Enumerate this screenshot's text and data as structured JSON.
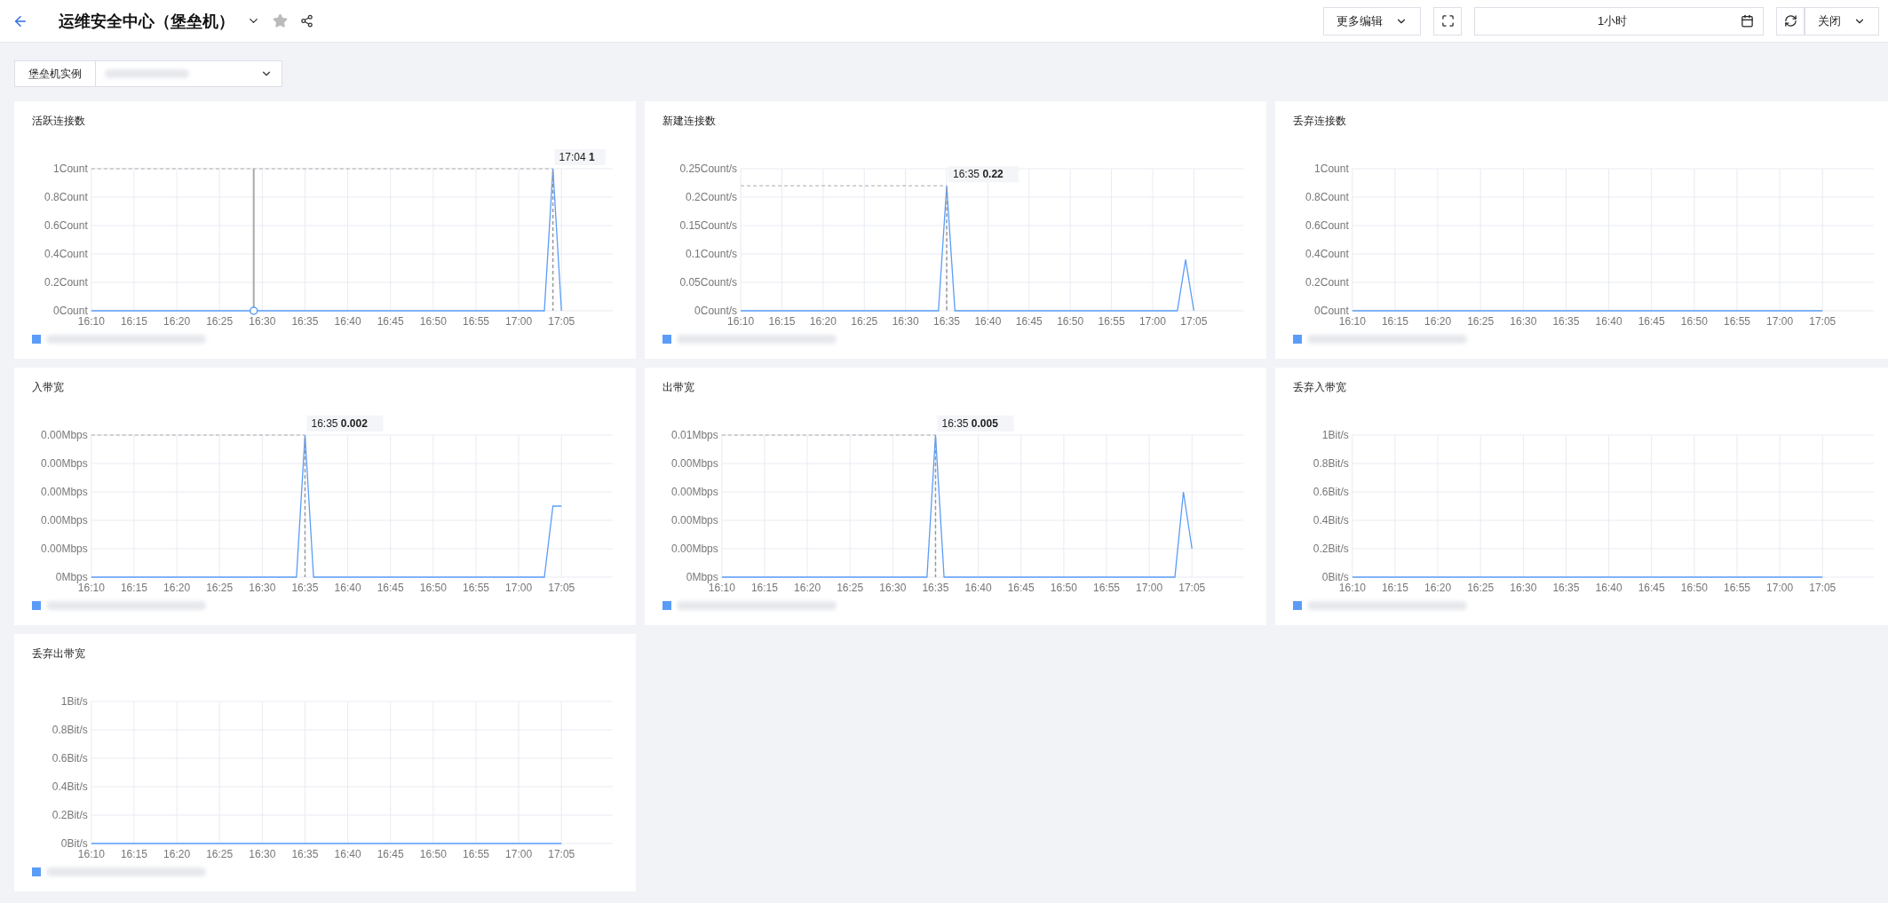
{
  "header": {
    "title": "运维安全中心（堡垒机）",
    "starred": false,
    "buttons": [
      {
        "kind": "dropdown",
        "label": "更多编辑"
      },
      {
        "kind": "fullscreen"
      },
      {
        "kind": "timerange",
        "label": "1小时"
      },
      {
        "kind": "refresh"
      },
      {
        "kind": "dropdown",
        "label": "关闭"
      }
    ]
  },
  "filter": {
    "label": "堡垒机实例"
  },
  "panels": [
    {
      "title": "活跃连接数",
      "tooltip": {
        "time": "17:04",
        "value": "1"
      },
      "chart_data": {
        "type": "line",
        "grid": true,
        "categories": [
          "16:10",
          null,
          null,
          null,
          null,
          "16:15",
          null,
          null,
          null,
          null,
          "16:20",
          null,
          null,
          null,
          null,
          "16:25",
          null,
          null,
          null,
          null,
          "16:30",
          null,
          null,
          null,
          null,
          "16:35",
          null,
          null,
          null,
          null,
          "16:40",
          null,
          null,
          null,
          null,
          "16:45",
          null,
          null,
          null,
          null,
          "16:50",
          null,
          null,
          null,
          null,
          "16:55",
          null,
          null,
          null,
          null,
          "17:00",
          null,
          null,
          null,
          null,
          "17:05"
        ],
        "ylim": [
          0,
          1
        ],
        "yticks": [
          {
            "value": 0,
            "label": "0Count"
          },
          {
            "value": 0.2,
            "label": "0.2Count"
          },
          {
            "value": 0.4,
            "label": "0.4Count"
          },
          {
            "value": 0.6,
            "label": "0.6Count"
          },
          {
            "value": 0.8,
            "label": "0.8Count"
          },
          {
            "value": 1,
            "label": "1Count"
          }
        ],
        "series": [
          {
            "color": "#5b9cf8",
            "values": [
              0,
              0,
              0,
              0,
              0,
              0,
              0,
              0,
              0,
              0,
              0,
              0,
              0,
              0,
              0,
              0,
              0,
              0,
              0,
              0,
              0,
              0,
              0,
              0,
              0,
              0,
              0,
              0,
              0,
              0,
              0,
              0,
              0,
              0,
              0,
              0,
              0,
              0,
              0,
              0,
              0,
              0,
              0,
              0,
              0,
              0,
              0,
              0,
              0,
              0,
              0,
              0,
              0,
              0,
              1,
              0
            ]
          }
        ],
        "ref_lines": [
          {
            "axis": "y",
            "value": 1
          }
        ]
      }
    },
    {
      "title": "新建连接数",
      "tooltip": {
        "time": "16:35",
        "value": "0.22"
      },
      "chart_data": {
        "type": "line",
        "grid": true,
        "categories": [
          "16:10",
          null,
          null,
          null,
          null,
          "16:15",
          null,
          null,
          null,
          null,
          "16:20",
          null,
          null,
          null,
          null,
          "16:25",
          null,
          null,
          null,
          null,
          "16:30",
          null,
          null,
          null,
          null,
          "16:35",
          null,
          null,
          null,
          null,
          "16:40",
          null,
          null,
          null,
          null,
          "16:45",
          null,
          null,
          null,
          null,
          "16:50",
          null,
          null,
          null,
          null,
          "16:55",
          null,
          null,
          null,
          null,
          "17:00",
          null,
          null,
          null,
          null,
          "17:05"
        ],
        "ylim": [
          0,
          0.25
        ],
        "yticks": [
          {
            "value": 0,
            "label": "0Count/s"
          },
          {
            "value": 0.05,
            "label": "0.05Count/s"
          },
          {
            "value": 0.1,
            "label": "0.1Count/s"
          },
          {
            "value": 0.15,
            "label": "0.15Count/s"
          },
          {
            "value": 0.2,
            "label": "0.2Count/s"
          },
          {
            "value": 0.25,
            "label": "0.25Count/s"
          }
        ],
        "series": [
          {
            "color": "#5b9cf8",
            "values": [
              0,
              0,
              0,
              0,
              0,
              0,
              0,
              0,
              0,
              0,
              0,
              0,
              0,
              0,
              0,
              0,
              0,
              0,
              0,
              0,
              0,
              0,
              0,
              0,
              0,
              0.22,
              0,
              0,
              0,
              0,
              0,
              0,
              0,
              0,
              0,
              0,
              0,
              0,
              0,
              0,
              0,
              0,
              0,
              0,
              0,
              0,
              0,
              0,
              0,
              0,
              0,
              0,
              0,
              0,
              0.09,
              0
            ]
          }
        ],
        "ref_lines": [
          {
            "axis": "y",
            "value": 0.22
          }
        ]
      }
    },
    {
      "title": "丢弃连接数",
      "chart_data": {
        "type": "line",
        "grid": true,
        "categories": [
          "16:10",
          null,
          null,
          null,
          null,
          "16:15",
          null,
          null,
          null,
          null,
          "16:20",
          null,
          null,
          null,
          null,
          "16:25",
          null,
          null,
          null,
          null,
          "16:30",
          null,
          null,
          null,
          null,
          "16:35",
          null,
          null,
          null,
          null,
          "16:40",
          null,
          null,
          null,
          null,
          "16:45",
          null,
          null,
          null,
          null,
          "16:50",
          null,
          null,
          null,
          null,
          "16:55",
          null,
          null,
          null,
          null,
          "17:00",
          null,
          null,
          null,
          null,
          "17:05"
        ],
        "ylim": [
          0,
          1
        ],
        "yticks": [
          {
            "value": 0,
            "label": "0Count"
          },
          {
            "value": 0.2,
            "label": "0.2Count"
          },
          {
            "value": 0.4,
            "label": "0.4Count"
          },
          {
            "value": 0.6,
            "label": "0.6Count"
          },
          {
            "value": 0.8,
            "label": "0.8Count"
          },
          {
            "value": 1,
            "label": "1Count"
          }
        ],
        "series": [
          {
            "color": "#5b9cf8",
            "values": [
              0,
              0,
              0,
              0,
              0,
              0,
              0,
              0,
              0,
              0,
              0,
              0,
              0,
              0,
              0,
              0,
              0,
              0,
              0,
              0,
              0,
              0,
              0,
              0,
              0,
              0,
              0,
              0,
              0,
              0,
              0,
              0,
              0,
              0,
              0,
              0,
              0,
              0,
              0,
              0,
              0,
              0,
              0,
              0,
              0,
              0,
              0,
              0,
              0,
              0,
              0,
              0,
              0,
              0,
              0,
              0
            ]
          }
        ]
      }
    },
    {
      "title": "入带宽",
      "tooltip": {
        "time": "16:35",
        "value": "0.002"
      },
      "chart_data": {
        "type": "line",
        "grid": true,
        "categories": [
          "16:10",
          null,
          null,
          null,
          null,
          "16:15",
          null,
          null,
          null,
          null,
          "16:20",
          null,
          null,
          null,
          null,
          "16:25",
          null,
          null,
          null,
          null,
          "16:30",
          null,
          null,
          null,
          null,
          "16:35",
          null,
          null,
          null,
          null,
          "16:40",
          null,
          null,
          null,
          null,
          "16:45",
          null,
          null,
          null,
          null,
          "16:50",
          null,
          null,
          null,
          null,
          "16:55",
          null,
          null,
          null,
          null,
          "17:00",
          null,
          null,
          null,
          null,
          "17:05"
        ],
        "ylim": [
          0,
          0.002
        ],
        "yticks": [
          {
            "value": 0,
            "label": "0Mbps"
          },
          {
            "value": 0.0004,
            "label": "0.00Mbps"
          },
          {
            "value": 0.0008,
            "label": "0.00Mbps"
          },
          {
            "value": 0.0012,
            "label": "0.00Mbps"
          },
          {
            "value": 0.0016,
            "label": "0.00Mbps"
          },
          {
            "value": 0.002,
            "label": "0.00Mbps"
          }
        ],
        "series": [
          {
            "color": "#5b9cf8",
            "values": [
              0,
              0,
              0,
              0,
              0,
              0,
              0,
              0,
              0,
              0,
              0,
              0,
              0,
              0,
              0,
              0,
              0,
              0,
              0,
              0,
              0,
              0,
              0,
              0,
              0,
              0.002,
              0,
              0,
              0,
              0,
              0,
              0,
              0,
              0,
              0,
              0,
              0,
              0,
              0,
              0,
              0,
              0,
              0,
              0,
              0,
              0,
              0,
              0,
              0,
              0,
              0,
              0,
              0,
              0,
              0.001,
              0.001
            ]
          }
        ],
        "ref_lines": [
          {
            "axis": "y",
            "value": 0.002
          }
        ]
      }
    },
    {
      "title": "出带宽",
      "tooltip": {
        "time": "16:35",
        "value": "0.005"
      },
      "chart_data": {
        "type": "line",
        "grid": true,
        "categories": [
          "16:10",
          null,
          null,
          null,
          null,
          "16:15",
          null,
          null,
          null,
          null,
          "16:20",
          null,
          null,
          null,
          null,
          "16:25",
          null,
          null,
          null,
          null,
          "16:30",
          null,
          null,
          null,
          null,
          "16:35",
          null,
          null,
          null,
          null,
          "16:40",
          null,
          null,
          null,
          null,
          "16:45",
          null,
          null,
          null,
          null,
          "16:50",
          null,
          null,
          null,
          null,
          "16:55",
          null,
          null,
          null,
          null,
          "17:00",
          null,
          null,
          null,
          null,
          "17:05"
        ],
        "ylim": [
          0,
          0.005
        ],
        "yticks": [
          {
            "value": 0,
            "label": "0Mbps"
          },
          {
            "value": 0.001,
            "label": "0.00Mbps"
          },
          {
            "value": 0.002,
            "label": "0.00Mbps"
          },
          {
            "value": 0.003,
            "label": "0.00Mbps"
          },
          {
            "value": 0.004,
            "label": "0.00Mbps"
          },
          {
            "value": 0.005,
            "label": "0.01Mbps"
          }
        ],
        "series": [
          {
            "color": "#5b9cf8",
            "values": [
              0,
              0,
              0,
              0,
              0,
              0,
              0,
              0,
              0,
              0,
              0,
              0,
              0,
              0,
              0,
              0,
              0,
              0,
              0,
              0,
              0,
              0,
              0,
              0,
              0,
              0.005,
              0,
              0,
              0,
              0,
              0,
              0,
              0,
              0,
              0,
              0,
              0,
              0,
              0,
              0,
              0,
              0,
              0,
              0,
              0,
              0,
              0,
              0,
              0,
              0,
              0,
              0,
              0,
              0,
              0.003,
              0.001
            ]
          }
        ],
        "ref_lines": [
          {
            "axis": "y",
            "value": 0.005
          }
        ]
      }
    },
    {
      "title": "丢弃入带宽",
      "chart_data": {
        "type": "line",
        "grid": true,
        "categories": [
          "16:10",
          null,
          null,
          null,
          null,
          "16:15",
          null,
          null,
          null,
          null,
          "16:20",
          null,
          null,
          null,
          null,
          "16:25",
          null,
          null,
          null,
          null,
          "16:30",
          null,
          null,
          null,
          null,
          "16:35",
          null,
          null,
          null,
          null,
          "16:40",
          null,
          null,
          null,
          null,
          "16:45",
          null,
          null,
          null,
          null,
          "16:50",
          null,
          null,
          null,
          null,
          "16:55",
          null,
          null,
          null,
          null,
          "17:00",
          null,
          null,
          null,
          null,
          "17:05"
        ],
        "ylim": [
          0,
          1
        ],
        "yticks": [
          {
            "value": 0,
            "label": "0Bit/s"
          },
          {
            "value": 0.2,
            "label": "0.2Bit/s"
          },
          {
            "value": 0.4,
            "label": "0.4Bit/s"
          },
          {
            "value": 0.6,
            "label": "0.6Bit/s"
          },
          {
            "value": 0.8,
            "label": "0.8Bit/s"
          },
          {
            "value": 1,
            "label": "1Bit/s"
          }
        ],
        "series": [
          {
            "color": "#5b9cf8",
            "values": [
              0,
              0,
              0,
              0,
              0,
              0,
              0,
              0,
              0,
              0,
              0,
              0,
              0,
              0,
              0,
              0,
              0,
              0,
              0,
              0,
              0,
              0,
              0,
              0,
              0,
              0,
              0,
              0,
              0,
              0,
              0,
              0,
              0,
              0,
              0,
              0,
              0,
              0,
              0,
              0,
              0,
              0,
              0,
              0,
              0,
              0,
              0,
              0,
              0,
              0,
              0,
              0,
              0,
              0,
              0,
              0
            ]
          }
        ]
      }
    },
    {
      "title": "丢弃出带宽",
      "chart_data": {
        "type": "line",
        "grid": true,
        "categories": [
          "16:10",
          null,
          null,
          null,
          null,
          "16:15",
          null,
          null,
          null,
          null,
          "16:20",
          null,
          null,
          null,
          null,
          "16:25",
          null,
          null,
          null,
          null,
          "16:30",
          null,
          null,
          null,
          null,
          "16:35",
          null,
          null,
          null,
          null,
          "16:40",
          null,
          null,
          null,
          null,
          "16:45",
          null,
          null,
          null,
          null,
          "16:50",
          null,
          null,
          null,
          null,
          "16:55",
          null,
          null,
          null,
          null,
          "17:00",
          null,
          null,
          null,
          null,
          "17:05"
        ],
        "ylim": [
          0,
          1
        ],
        "yticks": [
          {
            "value": 0,
            "label": "0Bit/s"
          },
          {
            "value": 0.2,
            "label": "0.2Bit/s"
          },
          {
            "value": 0.4,
            "label": "0.4Bit/s"
          },
          {
            "value": 0.6,
            "label": "0.6Bit/s"
          },
          {
            "value": 0.8,
            "label": "0.8Bit/s"
          },
          {
            "value": 1,
            "label": "1Bit/s"
          }
        ],
        "series": [
          {
            "color": "#5b9cf8",
            "values": [
              0,
              0,
              0,
              0,
              0,
              0,
              0,
              0,
              0,
              0,
              0,
              0,
              0,
              0,
              0,
              0,
              0,
              0,
              0,
              0,
              0,
              0,
              0,
              0,
              0,
              0,
              0,
              0,
              0,
              0,
              0,
              0,
              0,
              0,
              0,
              0,
              0,
              0,
              0,
              0,
              0,
              0,
              0,
              0,
              0,
              0,
              0,
              0,
              0,
              0,
              0,
              0,
              0,
              0,
              0,
              0
            ]
          }
        ]
      }
    }
  ]
}
